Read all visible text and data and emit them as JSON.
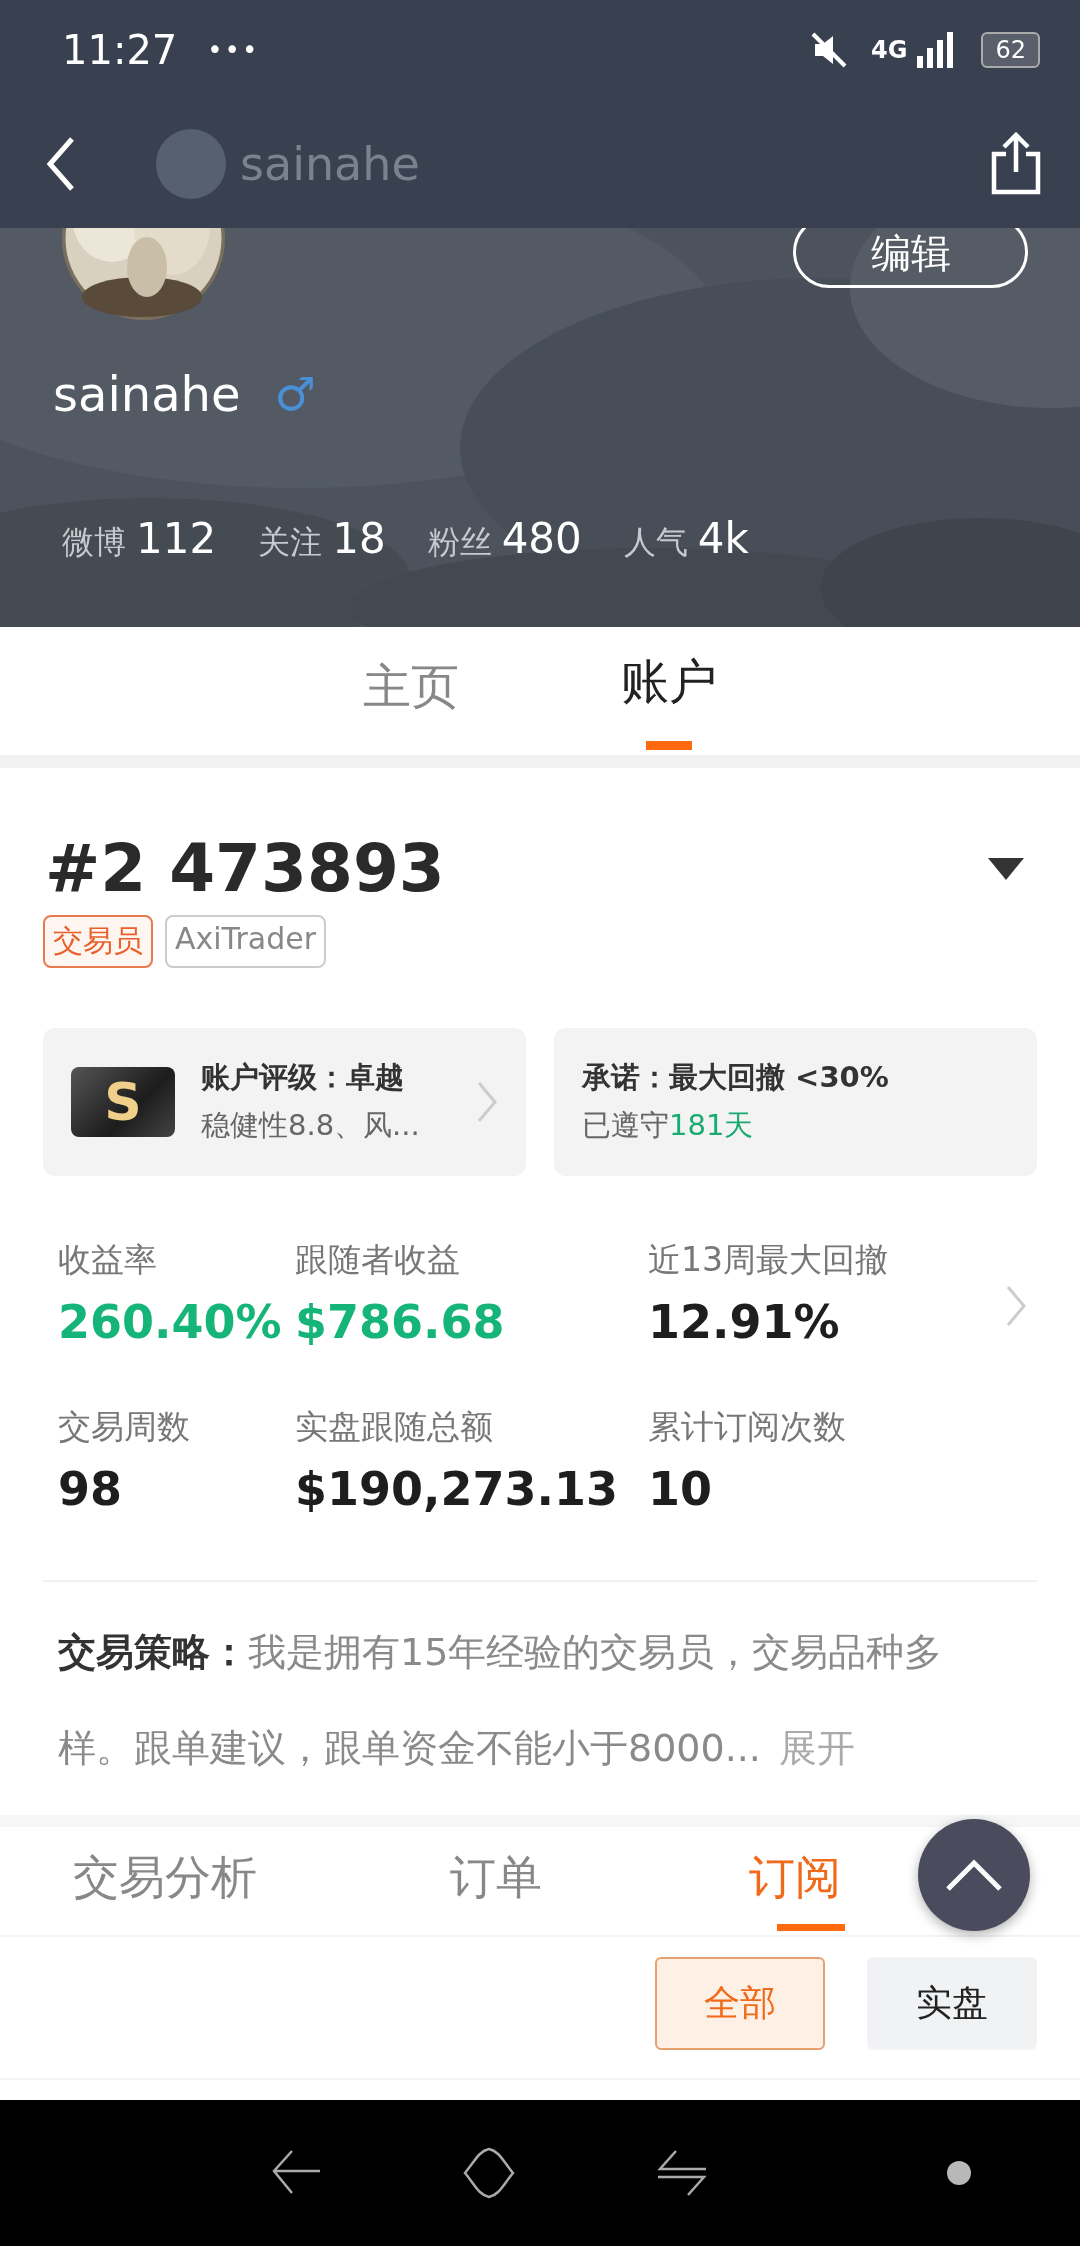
{
  "status_bar": {
    "time": "11:27",
    "more": "•••",
    "network": "4G",
    "battery": "62"
  },
  "nav": {
    "title": "sainahe"
  },
  "profile": {
    "name": "sainahe",
    "gender_symbol": "♂",
    "edit_button": "编辑",
    "stats": [
      {
        "label": "微博",
        "value": "112"
      },
      {
        "label": "关注",
        "value": "18"
      },
      {
        "label": "粉丝",
        "value": "480"
      },
      {
        "label": "人气",
        "value": "4k"
      }
    ]
  },
  "tabs": [
    {
      "label": "主页",
      "selected": false
    },
    {
      "label": "账户",
      "selected": true
    }
  ],
  "account": {
    "title": "#2 473893",
    "tags": [
      {
        "label": "交易员",
        "kind": "role"
      },
      {
        "label": "AxiTrader",
        "kind": "broker"
      }
    ],
    "rating_card": {
      "badge": "S",
      "title": "账户评级：卓越",
      "subtitle": "稳健性8.8、风..."
    },
    "promise_card": {
      "title": "承诺：最大回撤 <30%",
      "kept_prefix": "已遵守",
      "kept_days": "181天"
    },
    "metrics": [
      {
        "label": "收益率",
        "value": "260.40%",
        "color": "#15b57a"
      },
      {
        "label": "跟随者收益",
        "value": "$786.68",
        "color": "#15b57a"
      },
      {
        "label": "近13周最大回撤",
        "value": "12.91%",
        "color": "#1e1e1e"
      },
      {
        "label": "交易周数",
        "value": "98",
        "color": "#1e1e1e"
      },
      {
        "label": "实盘跟随总额",
        "value": "$190,273.13",
        "color": "#1e1e1e"
      },
      {
        "label": "累计订阅次数",
        "value": "10",
        "color": "#1e1e1e"
      }
    ],
    "strategy": {
      "label": "交易策略：",
      "text": "我是拥有15年经验的交易员，交易品种多样。跟单建议，跟单资金不能小于8000...",
      "expand": "展开"
    }
  },
  "sub_tabs": [
    {
      "label": "交易分析",
      "selected": false
    },
    {
      "label": "订单",
      "selected": false
    },
    {
      "label": "订阅",
      "selected": true
    }
  ],
  "filters": [
    {
      "label": "全部",
      "selected": true
    },
    {
      "label": "实盘",
      "selected": false
    }
  ]
}
